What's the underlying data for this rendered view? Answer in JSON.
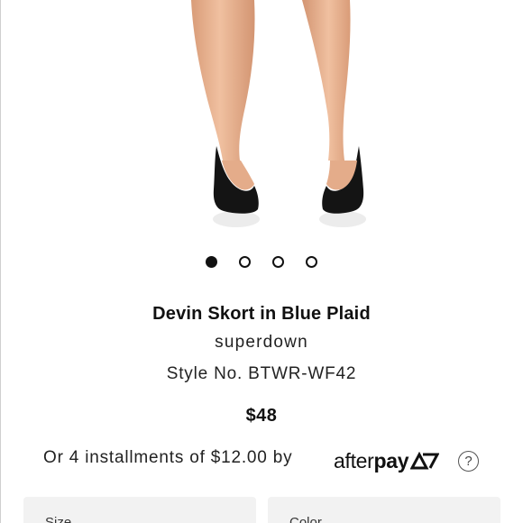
{
  "product": {
    "title": "Devin Skort in Blue Plaid",
    "brand": "superdown",
    "style_no": "Style No. BTWR-WF42",
    "price": "$48"
  },
  "carousel": {
    "total": 4,
    "active_index": 0
  },
  "afterpay": {
    "installments_text": "Or 4 installments of $12.00 by",
    "logo_after": "after",
    "logo_pay": "pay",
    "help_glyph": "?",
    "help_icon": "question-circle-icon"
  },
  "selectors": {
    "size_label": "Size",
    "color_label": "Color"
  },
  "colors": {
    "skin": "#e8b08e",
    "shoe": "#141414",
    "afterpay_accent": "#2c6fb5"
  }
}
